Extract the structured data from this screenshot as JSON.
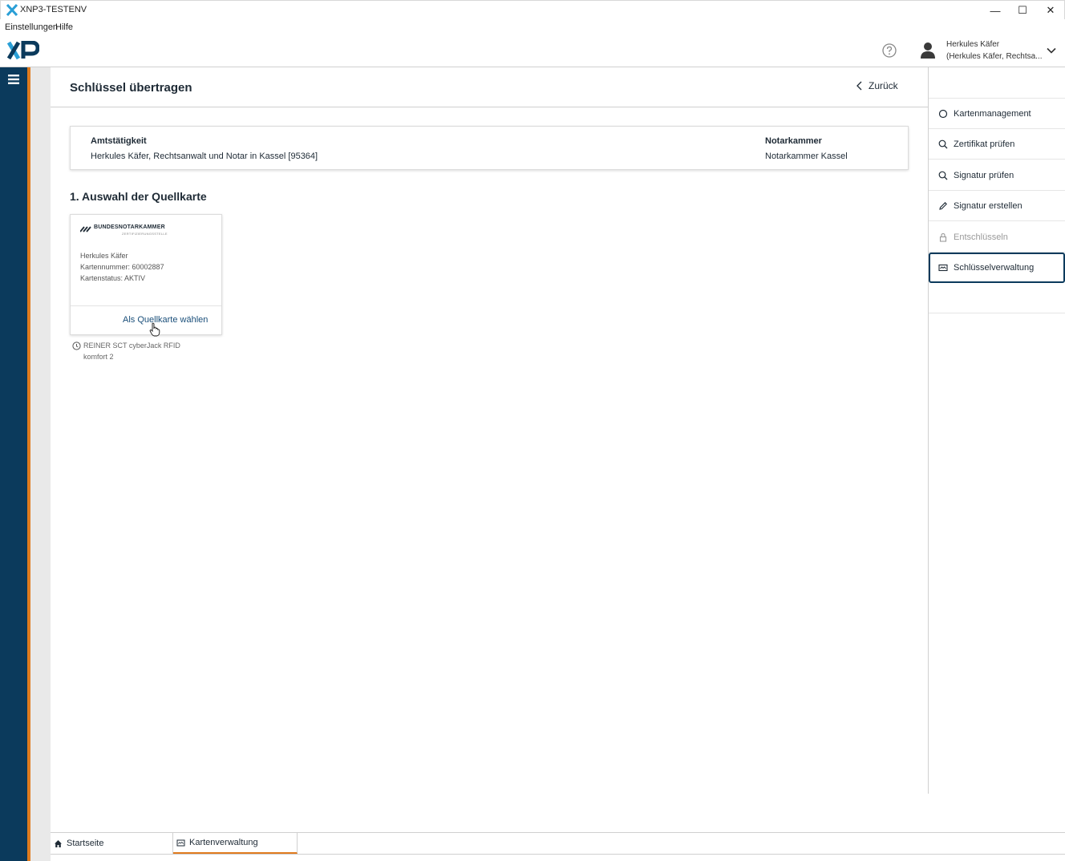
{
  "window": {
    "title": "XNP3-TESTENV",
    "minimize_label": "—",
    "maximize_label": "☐",
    "close_label": "✕"
  },
  "menu": {
    "settings": "Einstellungen",
    "help": "Hilfe"
  },
  "header": {
    "user_name": "Herkules Käfer",
    "user_role": "(Herkules Käfer, Rechtsa..."
  },
  "page": {
    "title": "Schlüssel übertragen",
    "back_label": "Zurück"
  },
  "info": {
    "office_label": "Amtstätigkeit",
    "office_value": "Herkules Käfer, Rechtsanwalt und Notar in Kassel [95364]",
    "chamber_label": "Notarkammer",
    "chamber_value": "Notarkammer Kassel"
  },
  "section": {
    "title": "1. Auswahl der Quellkarte"
  },
  "card": {
    "brand": "BUNDESNOTARKAMMER",
    "brand_sub": "ZERTIFIZIERUNGSSTELLE",
    "holder": "Herkules Käfer",
    "number": "Kartennummer: 60002887",
    "status": "Kartenstatus: AKTIV",
    "select_label": "Als Quellkarte wählen"
  },
  "reader": {
    "name": "REINER SCT cyberJack RFID komfort 2"
  },
  "sidebar": {
    "items": [
      {
        "label": "Kartenmanagement",
        "icon": "circle-icon",
        "state": "normal"
      },
      {
        "label": "Zertifikat prüfen",
        "icon": "search-icon",
        "state": "normal"
      },
      {
        "label": "Signatur prüfen",
        "icon": "search-icon",
        "state": "normal"
      },
      {
        "label": "Signatur erstellen",
        "icon": "pen-icon",
        "state": "normal"
      },
      {
        "label": "Entschlüsseln",
        "icon": "lock-icon",
        "state": "disabled"
      },
      {
        "label": "Schlüsselverwaltung",
        "icon": "card-icon",
        "state": "active"
      }
    ]
  },
  "tabs": {
    "home": "Startseite",
    "card_management": "Kartenverwaltung"
  },
  "colors": {
    "navy": "#0b3a5c",
    "orange": "#e07b1e",
    "link": "#1a4f7a"
  }
}
